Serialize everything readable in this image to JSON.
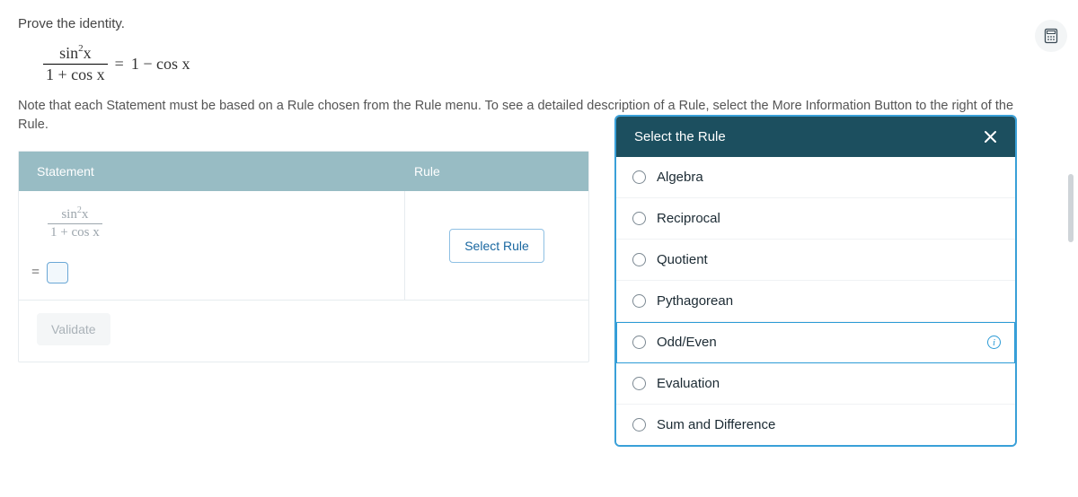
{
  "prompt": "Prove the identity.",
  "identity": {
    "numerator": "sin",
    "sup": "2",
    "numTail": "x",
    "denominator": "1 + cos x",
    "equals": "=",
    "rhs": "1 − cos x"
  },
  "note": "Note that each Statement must be based on a Rule chosen from the Rule menu. To see a detailed description of a Rule, select the More Information Button to the right of the Rule.",
  "table": {
    "headers": {
      "statement": "Statement",
      "rule": "Rule"
    },
    "frac": {
      "num": "sin",
      "sup": "2",
      "numTail": "x",
      "den": "1 + cos x"
    },
    "eq": "=",
    "selectRule": "Select Rule",
    "validate": "Validate"
  },
  "rulePanel": {
    "title": "Select the Rule",
    "items": [
      {
        "label": "Algebra"
      },
      {
        "label": "Reciprocal"
      },
      {
        "label": "Quotient"
      },
      {
        "label": "Pythagorean"
      },
      {
        "label": "Odd/Even",
        "highlight": true,
        "info": true
      },
      {
        "label": "Evaluation"
      },
      {
        "label": "Sum and Difference"
      }
    ]
  }
}
